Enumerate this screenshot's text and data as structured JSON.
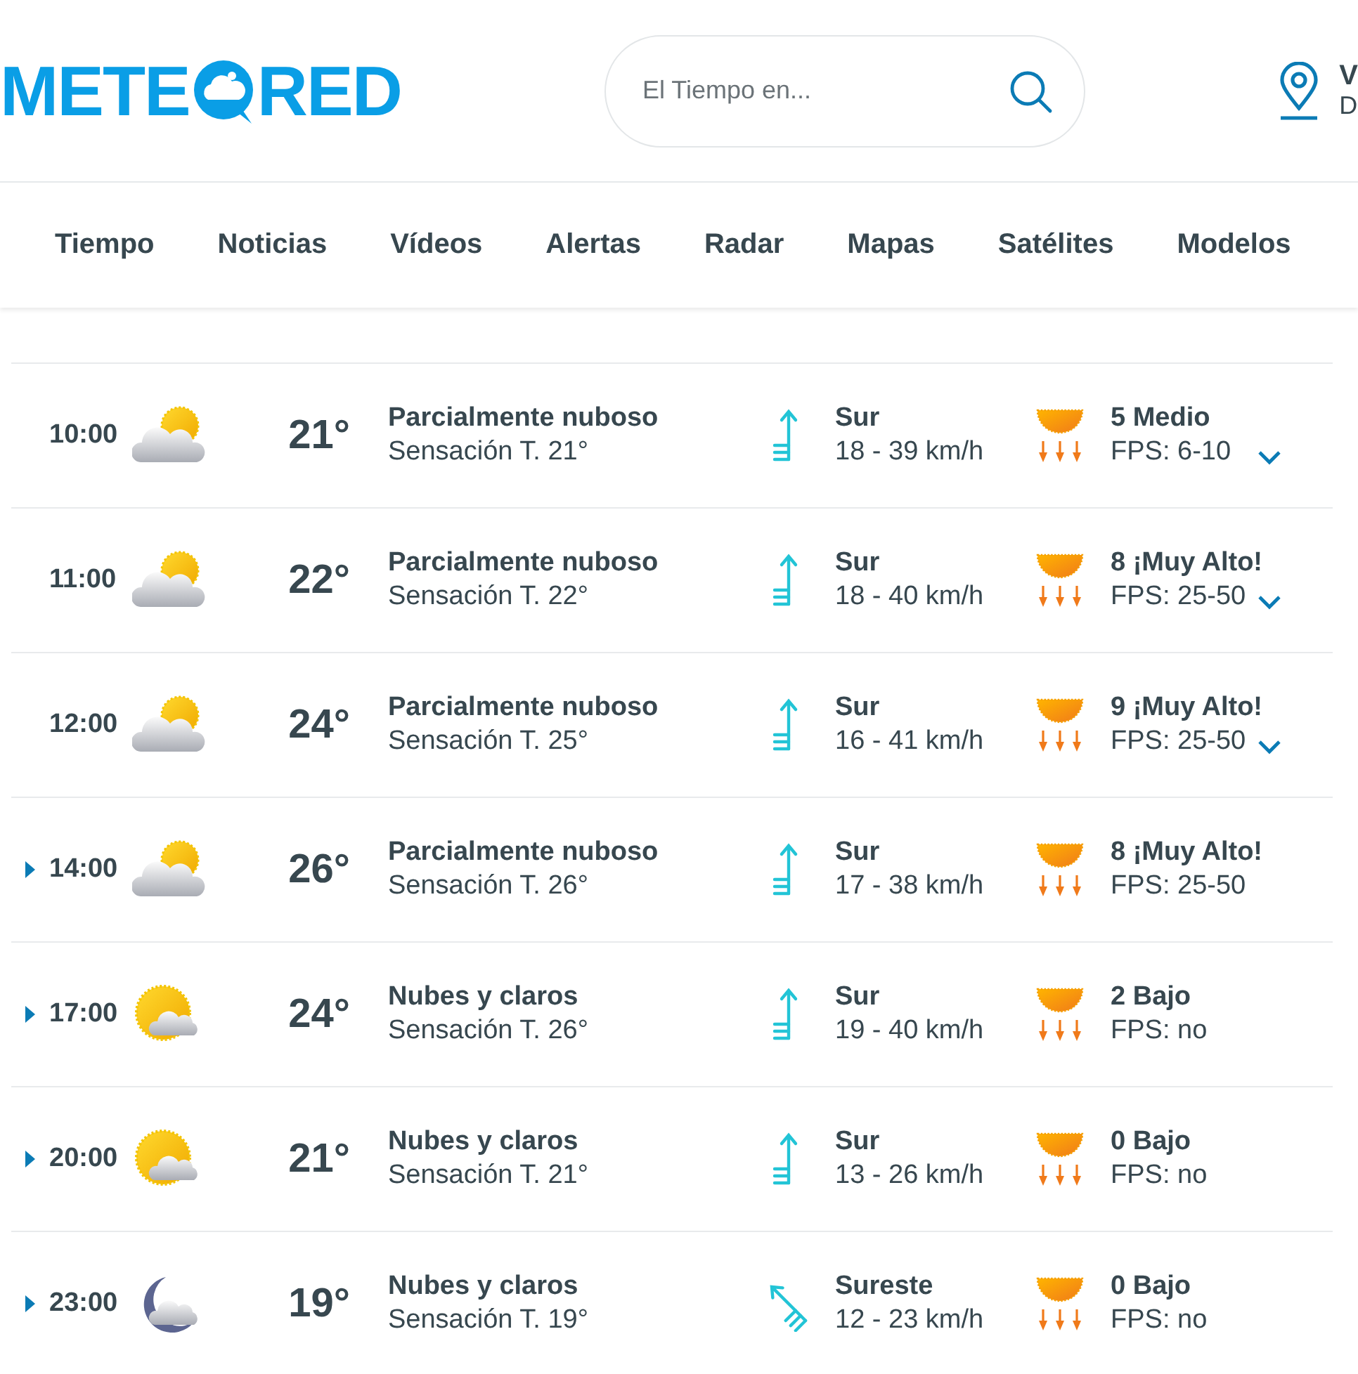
{
  "header": {
    "logo_left": "METE",
    "logo_right": "RED",
    "search": {
      "placeholder": "El Tiempo en..."
    },
    "location": {
      "line_1": "V",
      "line_2": "D"
    }
  },
  "nav": [
    "Tiempo",
    "Noticias",
    "Vídeos",
    "Alertas",
    "Radar",
    "Mapas",
    "Satélites",
    "Modelos"
  ],
  "rows": [
    {
      "time": "10:00",
      "toggle": {
        "kind": "chevron"
      },
      "sky": {
        "kind": "partly_cloudy"
      },
      "temp": "21°",
      "description": "Parcialmente nuboso",
      "feels": "Sensación T. 21°",
      "wind_arrow": {
        "kind": "south"
      },
      "wind_dir": "Sur",
      "wind_speed": "18 - 39 km/h",
      "uv": "5 Medio",
      "fps": "FPS: 6-10"
    },
    {
      "time": "11:00",
      "toggle": {
        "kind": "chevron"
      },
      "sky": {
        "kind": "partly_cloudy"
      },
      "temp": "22°",
      "description": "Parcialmente nuboso",
      "feels": "Sensación T. 22°",
      "wind_arrow": {
        "kind": "south"
      },
      "wind_dir": "Sur",
      "wind_speed": "18 - 40 km/h",
      "uv": "8 ¡Muy Alto!",
      "fps": "FPS: 25-50"
    },
    {
      "time": "12:00",
      "toggle": {
        "kind": "chevron"
      },
      "sky": {
        "kind": "partly_cloudy"
      },
      "temp": "24°",
      "description": "Parcialmente nuboso",
      "feels": "Sensación T. 25°",
      "wind_arrow": {
        "kind": "south"
      },
      "wind_dir": "Sur",
      "wind_speed": "16 - 41 km/h",
      "uv": "9 ¡Muy Alto!",
      "fps": "FPS: 25-50"
    },
    {
      "time": "14:00",
      "toggle": {
        "kind": "triangle"
      },
      "sky": {
        "kind": "partly_cloudy"
      },
      "temp": "26°",
      "description": "Parcialmente nuboso",
      "feels": "Sensación T. 26°",
      "wind_arrow": {
        "kind": "south"
      },
      "wind_dir": "Sur",
      "wind_speed": "17 - 38 km/h",
      "uv": "8 ¡Muy Alto!",
      "fps": "FPS: 25-50"
    },
    {
      "time": "17:00",
      "toggle": {
        "kind": "triangle"
      },
      "sky": {
        "kind": "sun_clouds"
      },
      "temp": "24°",
      "description": "Nubes y claros",
      "feels": "Sensación T. 26°",
      "wind_arrow": {
        "kind": "south"
      },
      "wind_dir": "Sur",
      "wind_speed": "19 - 40 km/h",
      "uv": "2 Bajo",
      "fps": "FPS: no"
    },
    {
      "time": "20:00",
      "toggle": {
        "kind": "triangle"
      },
      "sky": {
        "kind": "sun_clouds"
      },
      "temp": "21°",
      "description": "Nubes y claros",
      "feels": "Sensación T. 21°",
      "wind_arrow": {
        "kind": "south"
      },
      "wind_dir": "Sur",
      "wind_speed": "13 - 26 km/h",
      "uv": "0 Bajo",
      "fps": "FPS: no"
    },
    {
      "time": "23:00",
      "toggle": {
        "kind": "triangle"
      },
      "sky": {
        "kind": "moon_clouds"
      },
      "temp": "19°",
      "description": "Nubes y claros",
      "feels": "Sensación T. 19°",
      "wind_arrow": {
        "kind": "southeast"
      },
      "wind_dir": "Sureste",
      "wind_speed": "12 - 23 km/h",
      "uv": "0 Bajo",
      "fps": "FPS: no"
    }
  ]
}
